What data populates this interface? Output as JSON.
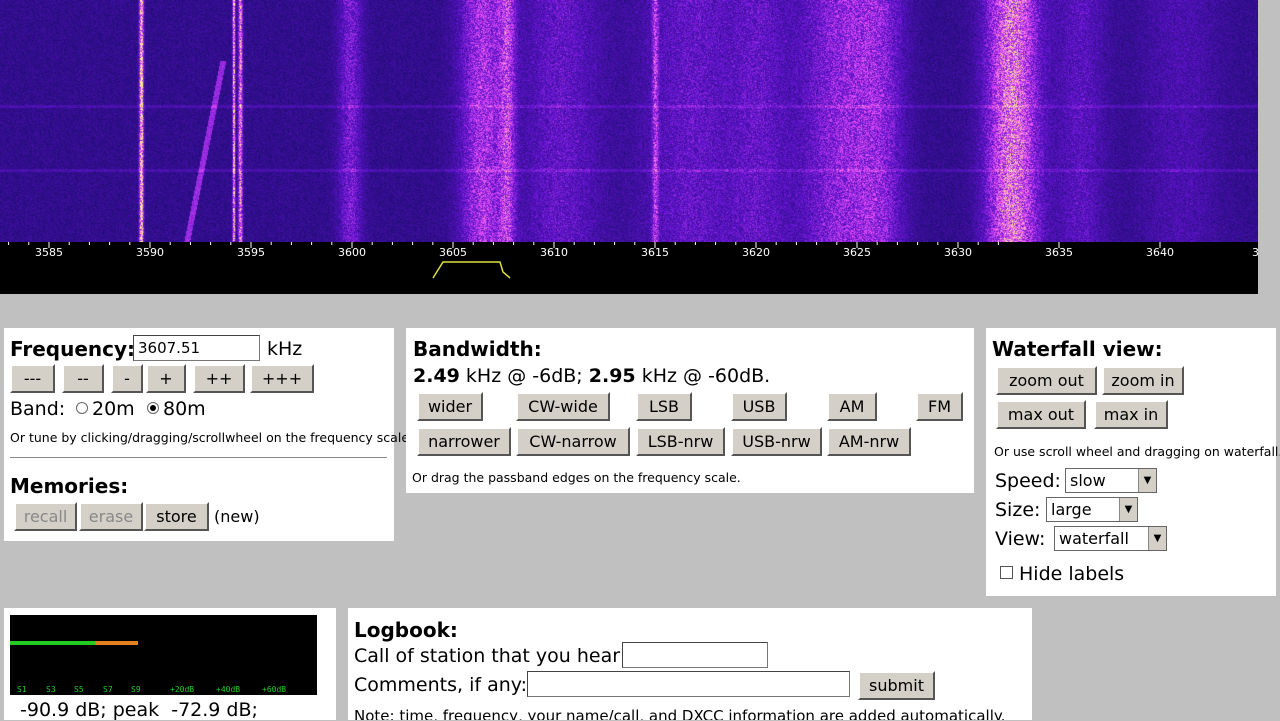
{
  "scale": {
    "ticks": [
      "3585",
      "3590",
      "3595",
      "3600",
      "3605",
      "3610",
      "3615",
      "3620",
      "3625",
      "3630",
      "3635",
      "3640",
      "36"
    ]
  },
  "frequency": {
    "label": "Frequency:",
    "value": "3607.51",
    "unit": "kHz",
    "step_buttons": [
      "---",
      "--",
      "-",
      "+",
      "++",
      "+++"
    ],
    "band_label": "Band:",
    "bands": [
      {
        "label": "20m",
        "selected": false
      },
      {
        "label": "80m",
        "selected": true
      }
    ],
    "hint": "Or tune by clicking/dragging/scrollwheel on the frequency scale."
  },
  "memories": {
    "title": "Memories:",
    "recall": "recall",
    "erase": "erase",
    "store": "store",
    "status": "(new)"
  },
  "bandwidth": {
    "title": "Bandwidth:",
    "value6": "2.49",
    "text6": " kHz @ -6dB; ",
    "value60": "2.95",
    "text60": " kHz @ -60dB.",
    "row1": [
      "wider",
      "CW-wide",
      "LSB",
      "USB",
      "AM",
      "FM"
    ],
    "row2": [
      "narrower",
      "CW-narrow",
      "LSB-nrw",
      "USB-nrw",
      "AM-nrw"
    ],
    "hint": "Or drag the passband edges on the frequency scale."
  },
  "waterfall_view": {
    "title": "Waterfall view:",
    "zoom_out": "zoom out",
    "zoom_in": "zoom in",
    "max_out": "max out",
    "max_in": "max in",
    "hint": "Or use scroll wheel and dragging on waterfall.",
    "speed_label": "Speed:",
    "speed_value": "slow",
    "size_label": "Size:",
    "size_value": "large",
    "view_label": "View:",
    "view_value": "waterfall",
    "hide_labels": "Hide labels"
  },
  "smeter": {
    "labels": [
      "S1",
      "S3",
      "S5",
      "S7",
      "S9",
      "+20dB",
      "+40dB",
      "+60dB"
    ],
    "readout": "-90.9 dB; peak  -72.9 dB;",
    "green_color": "#22cc22",
    "orange_color": "#e08020"
  },
  "logbook": {
    "title": "Logbook:",
    "call_label": "Call of station that you hear:",
    "comments_label": "Comments, if any:",
    "submit": "submit",
    "note": "Note: time, frequency, your name/call, and DXCC information are added automatically."
  }
}
